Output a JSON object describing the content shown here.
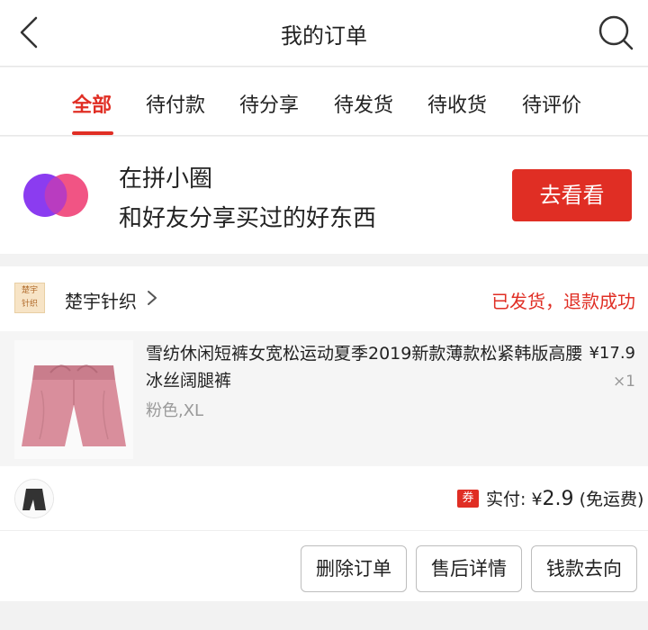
{
  "header": {
    "title": "我的订单"
  },
  "tabs": [
    {
      "label": "全部",
      "active": true
    },
    {
      "label": "待付款"
    },
    {
      "label": "待分享"
    },
    {
      "label": "待发货"
    },
    {
      "label": "待收货"
    },
    {
      "label": "待评价"
    }
  ],
  "banner": {
    "line1": "在拼小圈",
    "line2": "和好友分享买过的好东西",
    "button_label": "去看看"
  },
  "order": {
    "shop_logo_text": [
      "楚宇",
      "针织"
    ],
    "shop_name": "楚宇针织",
    "status": "已发货，退款成功",
    "product": {
      "title": "雪纺休闲短裤女宽松运动夏季2019新款薄款松紧韩版高腰冰丝阔腿裤",
      "spec": "粉色,XL",
      "price": "¥17.9",
      "quantity": "×1"
    },
    "payment": {
      "coupon_tag": "券",
      "label": "实付: ",
      "currency": "¥",
      "amount": "2.9",
      "shipping_note": " (免运费)"
    },
    "actions": {
      "delete": "删除订单",
      "after_sale": "售后详情",
      "money_flow": "钱款去向"
    }
  },
  "colors": {
    "accent": "#e02e24",
    "banner_logo_purple": "#8b3cf0",
    "banner_logo_pink": "#f0457a",
    "product_pink": "#d98e9c"
  }
}
